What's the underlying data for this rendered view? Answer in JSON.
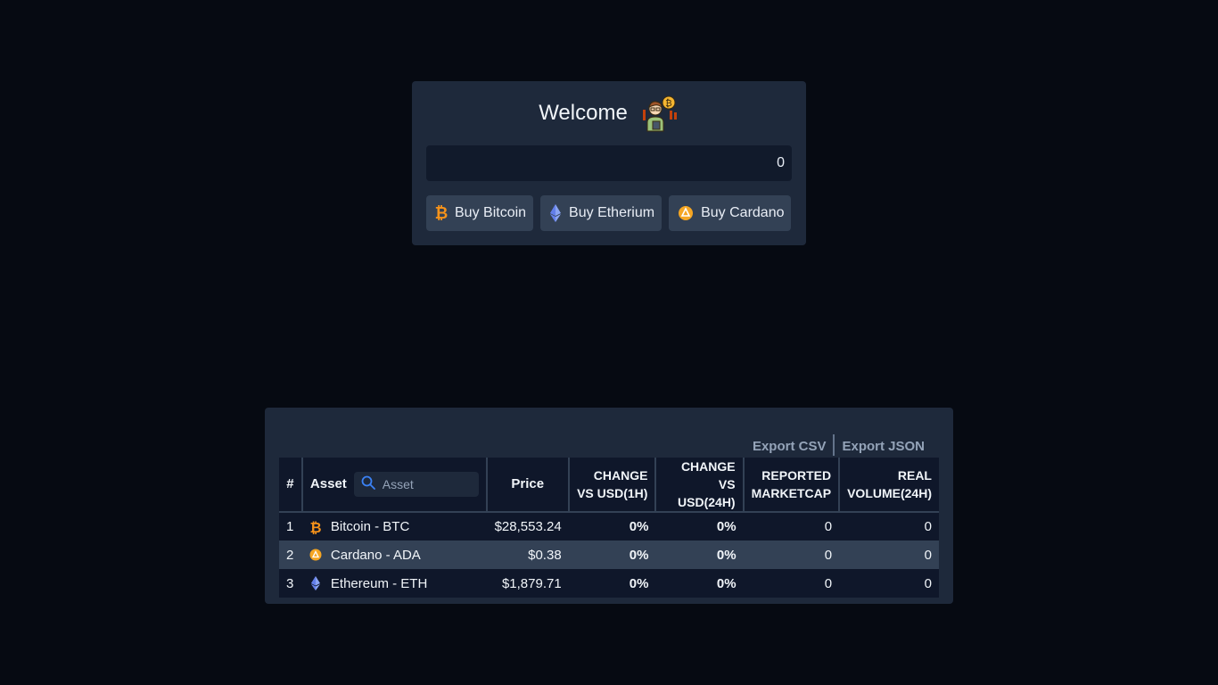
{
  "welcome": {
    "title": "Welcome",
    "amount_value": "0"
  },
  "buy_buttons": [
    {
      "label": "Buy Bitcoin",
      "icon": "bitcoin-icon",
      "color": "#f7931a"
    },
    {
      "label": "Buy Etherium",
      "icon": "ethereum-icon",
      "color": "#627eea"
    },
    {
      "label": "Buy Cardano",
      "icon": "cardano-icon",
      "color": "#f5a623"
    }
  ],
  "exports": {
    "csv_label": "Export CSV",
    "json_label": "Export JSON"
  },
  "table": {
    "headers": {
      "num": "#",
      "asset": "Asset",
      "search_placeholder": "Asset",
      "price": "Price",
      "change_1h": "CHANGE VS USD(1H)",
      "change_24h": "CHANGE VS USD(24H)",
      "marketcap": "REPORTED MARKETCAP",
      "volume": "REAL VOLUME(24H)"
    },
    "rows": [
      {
        "num": "1",
        "asset": "Bitcoin - BTC",
        "icon": "bitcoin-icon",
        "price": "$28,553.24",
        "change_1h": "0%",
        "change_24h": "0%",
        "marketcap": "0",
        "volume": "0"
      },
      {
        "num": "2",
        "asset": "Cardano - ADA",
        "icon": "cardano-icon",
        "price": "$0.38",
        "change_1h": "0%",
        "change_24h": "0%",
        "marketcap": "0",
        "volume": "0"
      },
      {
        "num": "3",
        "asset": "Ethereum - ETH",
        "icon": "ethereum-icon",
        "price": "$1,879.71",
        "change_1h": "0%",
        "change_24h": "0%",
        "marketcap": "0",
        "volume": "0"
      }
    ]
  },
  "colors": {
    "page_bg": "#060a12",
    "card_bg": "#1e293b",
    "row_alt": "#334155",
    "accent_search": "#3b82f6"
  }
}
